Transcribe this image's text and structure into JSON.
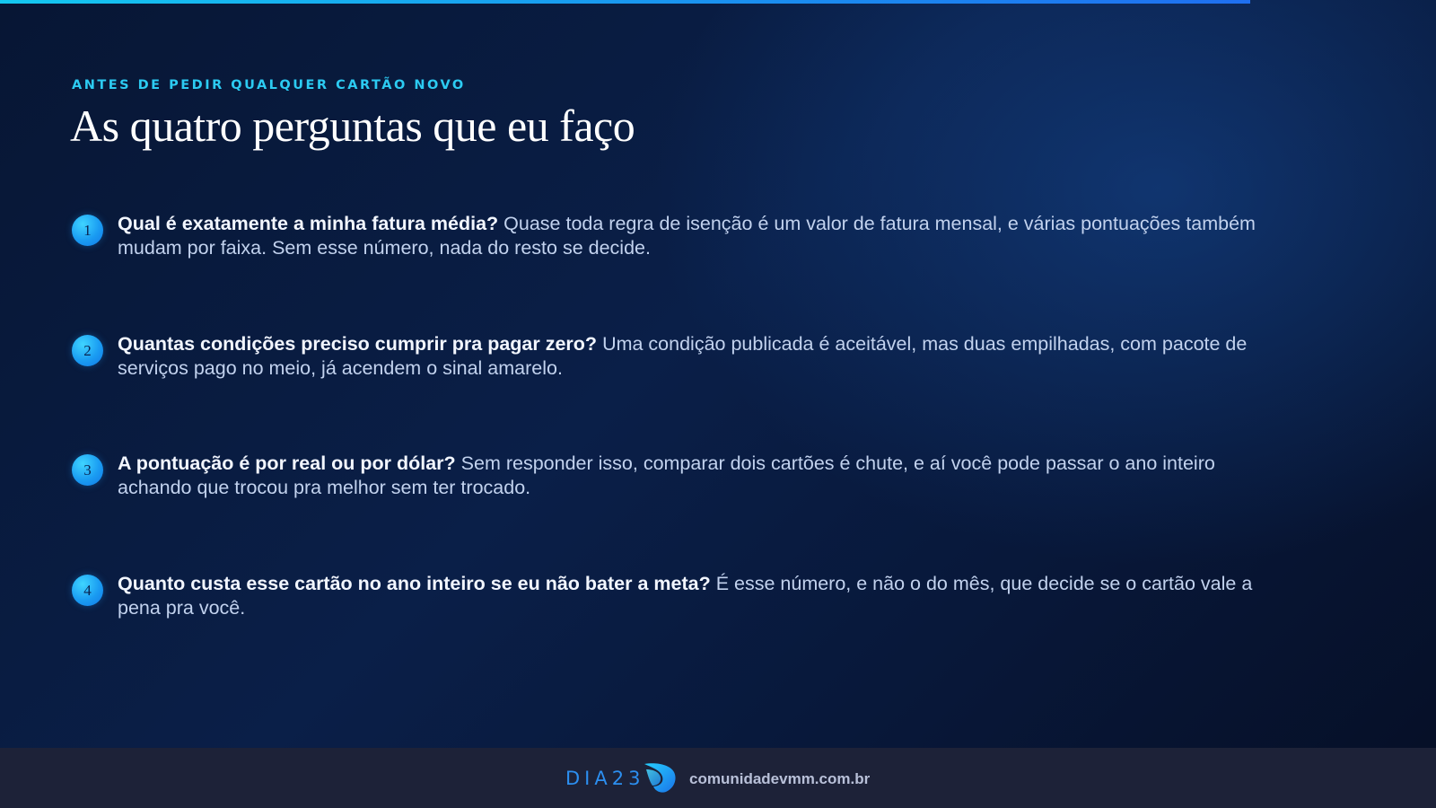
{
  "header": {
    "eyebrow": "ANTES DE PEDIR QUALQUER CARTÃO NOVO",
    "title": "As quatro perguntas que eu faço"
  },
  "questions": [
    {
      "number": "1",
      "question": "Qual é exatamente a minha fatura média?",
      "answer": "Quase toda regra de isenção é um valor de fatura mensal, e várias pontuações também mudam por faixa. Sem esse número, nada do resto se decide."
    },
    {
      "number": "2",
      "question": "Quantas condições preciso cumprir pra pagar zero?",
      "answer": "Uma condição publicada é aceitável, mas duas empilhadas, com pacote de serviços pago no meio, já acendem o sinal amarelo."
    },
    {
      "number": "3",
      "question": "A pontuação é por real ou por dólar?",
      "answer": "Sem responder isso, comparar dois cartões é chute, e aí você pode passar o ano inteiro achando que trocou pra melhor sem ter trocado."
    },
    {
      "number": "4",
      "question": "Quanto custa esse cartão no ano inteiro se eu não bater a meta?",
      "answer": "É esse número, e não o do mês, que decide se o cartão vale a pena pra você."
    }
  ],
  "footer": {
    "brand": "DIA23",
    "logo_icon": "wave-logo-icon",
    "site": "comunidadevmm.com.br"
  },
  "colors": {
    "accent": "#2ccbf2",
    "background": "#0a1f48",
    "footer_bg": "#1d2238"
  }
}
